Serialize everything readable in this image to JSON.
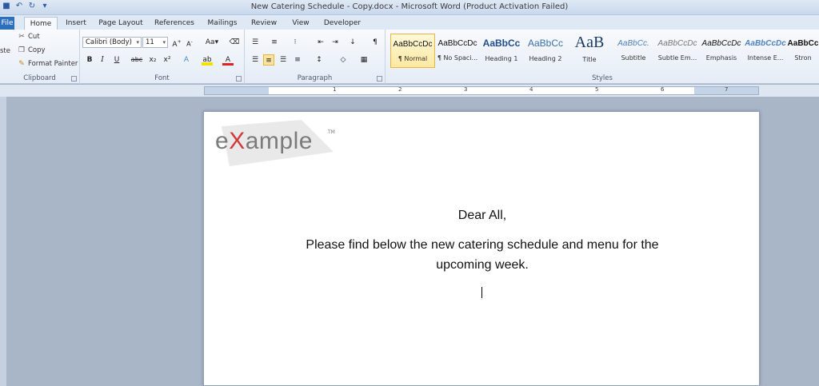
{
  "window": {
    "title": "New Catering Schedule - Copy.docx  -  Microsoft Word (Product Activation Failed)"
  },
  "tabs": [
    "File",
    "Home",
    "Insert",
    "Page Layout",
    "References",
    "Mailings",
    "Review",
    "View",
    "Developer"
  ],
  "clipboard": {
    "paste_label": "ste",
    "cut": "Cut",
    "copy": "Copy",
    "format_painter": "Format Painter",
    "group_label": "Clipboard"
  },
  "font": {
    "family": "Calibri (Body)",
    "size": "11",
    "group_label": "Font",
    "buttons": [
      "B",
      "I",
      "U",
      "abc",
      "x₂",
      "x²",
      "A",
      "ab",
      "A"
    ]
  },
  "paragraph": {
    "group_label": "Paragraph"
  },
  "styles": {
    "group_label": "Styles",
    "items": [
      {
        "sample": "AaBbCcDc",
        "name": "¶ Normal"
      },
      {
        "sample": "AaBbCcDc",
        "name": "¶ No Spaci..."
      },
      {
        "sample": "AaBbCc",
        "name": "Heading 1"
      },
      {
        "sample": "AaBbCc",
        "name": "Heading 2"
      },
      {
        "sample": "AaB",
        "name": "Title"
      },
      {
        "sample": "AaBbCc.",
        "name": "Subtitle"
      },
      {
        "sample": "AaBbCcDc",
        "name": "Subtle Em..."
      },
      {
        "sample": "AaBbCcDc",
        "name": "Emphasis"
      },
      {
        "sample": "AaBbCcDc",
        "name": "Intense E..."
      },
      {
        "sample": "AaBbCc",
        "name": "Stron"
      }
    ]
  },
  "ruler": {
    "numbers": [
      "1",
      "2",
      "3",
      "4",
      "5",
      "6",
      "7"
    ]
  },
  "document": {
    "logo_text_prefix": "e",
    "logo_text_x": "X",
    "logo_text_suffix": "ample",
    "logo_tm": "TM",
    "greeting": "Dear All,",
    "body_line1": "Please find below the new catering schedule and menu for the",
    "body_line2": "upcoming week."
  },
  "colors": {
    "accent": "#2c6fbf",
    "selected": "#fbe49c"
  }
}
